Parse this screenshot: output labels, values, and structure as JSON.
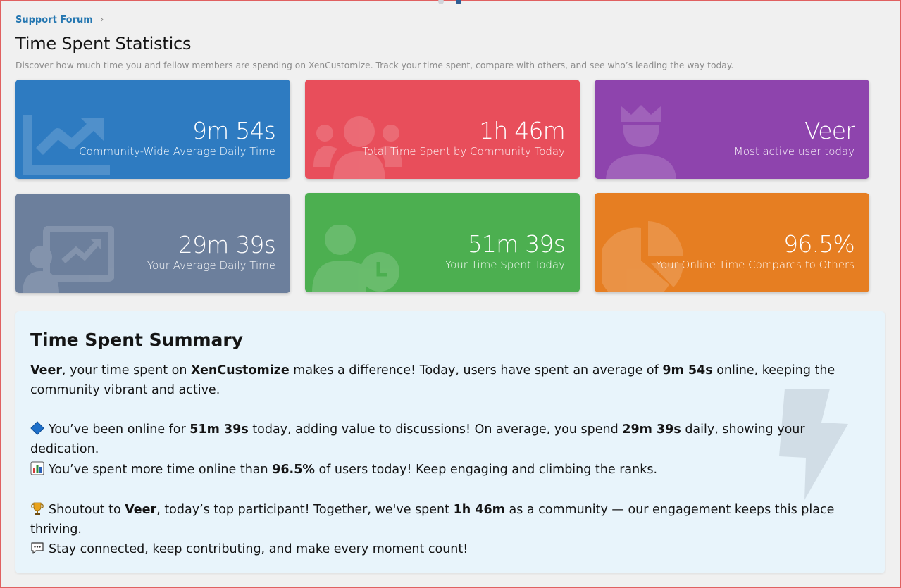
{
  "breadcrumb": {
    "label": "Support Forum",
    "separator": "›"
  },
  "header": {
    "title": "Time Spent Statistics",
    "description": "Discover how much time you and fellow members are spending on XenCustomize. Track your time spent, compare with others, and see who’s leading the way today."
  },
  "cards": [
    {
      "value": "9m 54s",
      "label": "Community-Wide Average Daily Time",
      "icon": "trending-up-chart-icon",
      "color": "#2e7bc1"
    },
    {
      "value": "1h 46m",
      "label": "Total Time Spent by Community Today",
      "icon": "users-group-icon",
      "color": "#e84e5b"
    },
    {
      "value": "Veer",
      "label": "Most active user today",
      "icon": "crowned-user-icon",
      "color": "#8e44ad"
    },
    {
      "value": "29m 39s",
      "label": "Your Average Daily Time",
      "icon": "user-presentation-icon",
      "color": "#6c7f9c"
    },
    {
      "value": "51m 39s",
      "label": "Your Time Spent Today",
      "icon": "user-clock-icon",
      "color": "#4caf50"
    },
    {
      "value": "96.5%",
      "label": "Your Online Time Compares to Others",
      "icon": "pie-chart-icon",
      "color": "#e67e22"
    }
  ],
  "summary": {
    "title": "Time Spent Summary",
    "p1": {
      "user": "Veer",
      "t1": ", your time spent on ",
      "site": "XenCustomize",
      "t2": " makes a difference! Today, users have spent an average of ",
      "avg": "9m 54s",
      "t3": " online, keeping the community vibrant and active."
    },
    "p2": {
      "t1": "You’ve been online for ",
      "today": "51m 39s",
      "t2": " today, adding value to discussions! On average, you spend ",
      "avg": "29m 39s",
      "t3": " daily, showing your dedication."
    },
    "p3": {
      "t1": "You’ve spent more time online than ",
      "pct": "96.5%",
      "t2": " of users today! Keep engaging and climbing the ranks."
    },
    "p4": {
      "t1": "Shoutout to ",
      "user": "Veer",
      "t2": ", today’s top participant! Together, we've spent ",
      "total": "1h 46m",
      "t3": " as a community — our engagement keeps this place thriving."
    },
    "p5": {
      "t1": "Stay connected, keep contributing, and make every moment count!"
    }
  },
  "colors": {
    "accent": "#2577b1",
    "summary_bg": "#e8f4fb"
  }
}
